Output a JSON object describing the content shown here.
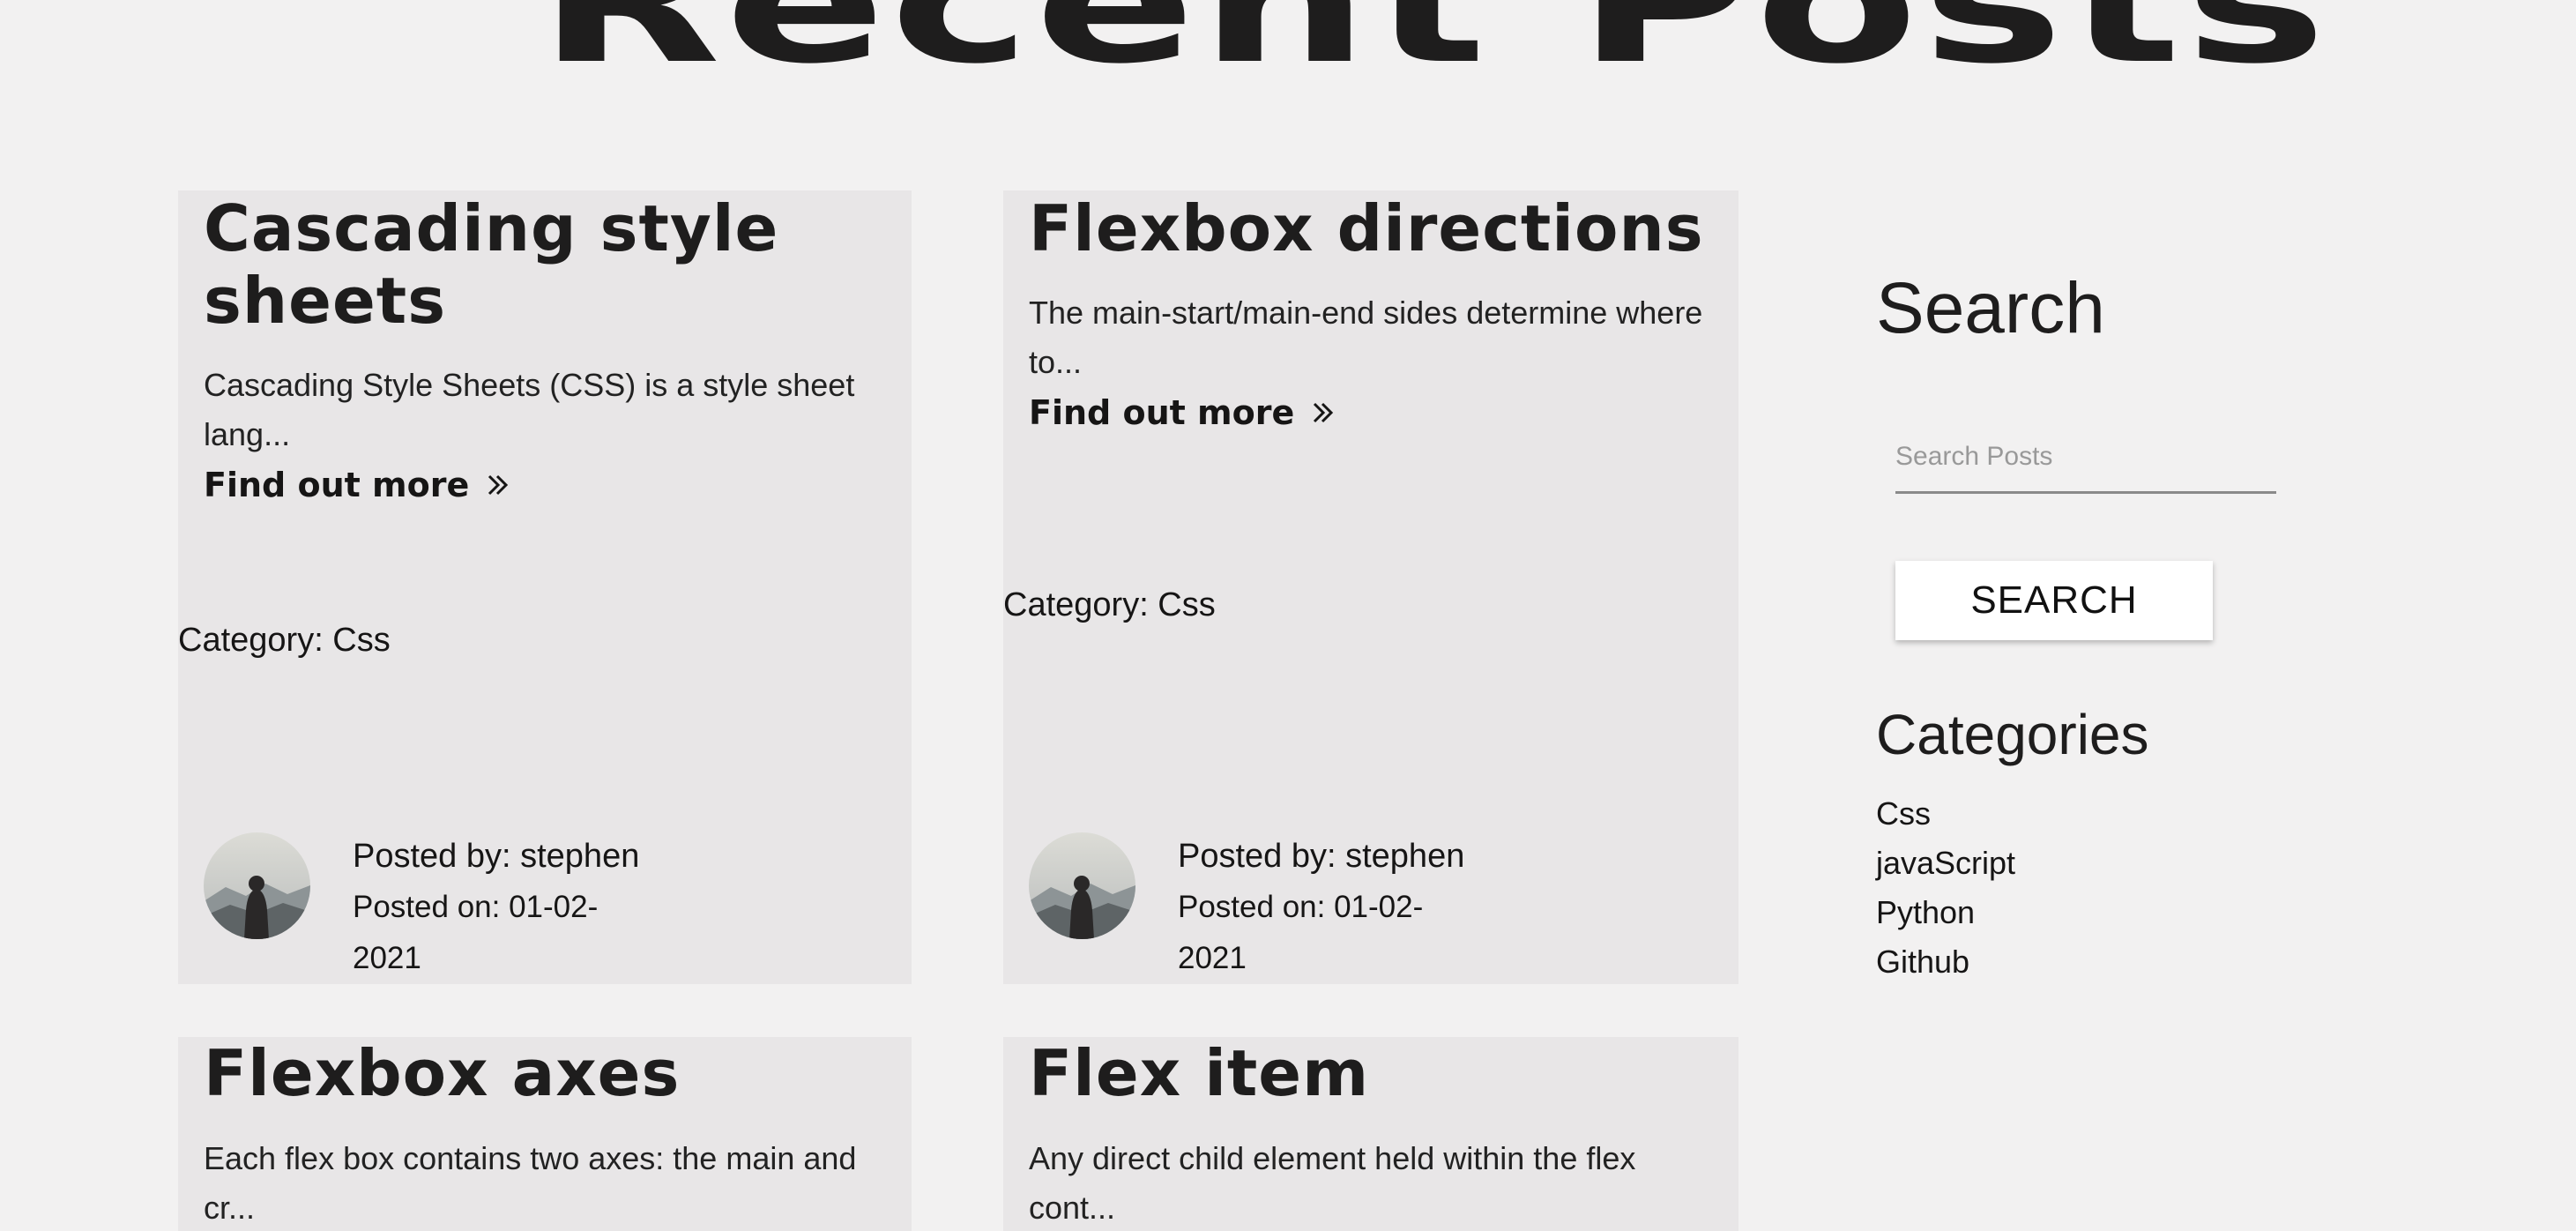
{
  "page": {
    "title": "Recent Posts"
  },
  "posts": [
    {
      "title": "Cascading style sheets",
      "excerpt": "Cascading Style Sheets (CSS) is a style sheet lang...",
      "link_label": "Find out more",
      "category": "Category: Css",
      "posted_by": "Posted by: stephen",
      "posted_on": "Posted on: 01-02-2021"
    },
    {
      "title": "Flexbox directions",
      "excerpt": "The main-start/main-end sides determine where to...",
      "link_label": "Find out more",
      "category": "Category: Css",
      "posted_by": "Posted by: stephen",
      "posted_on": "Posted on: 01-02-2021"
    },
    {
      "title": "Flexbox axes",
      "excerpt": "Each flex box contains two axes: the main and cr..."
    },
    {
      "title": "Flex item",
      "excerpt": "Any direct child element held within the flex cont..."
    }
  ],
  "sidebar": {
    "search_heading": "Search",
    "search_placeholder": "Search Posts",
    "search_button": "SEARCH",
    "categories_heading": "Categories",
    "categories": [
      "Css",
      "javaScript",
      "Python",
      "Github"
    ]
  },
  "icons": {
    "link_icon": "double-chevron-right-icon",
    "avatar": "hooded-figure-mountains"
  },
  "colors": {
    "background": "#f2f1f1",
    "card": "#e8e6e7",
    "text": "#1e1d1d"
  }
}
